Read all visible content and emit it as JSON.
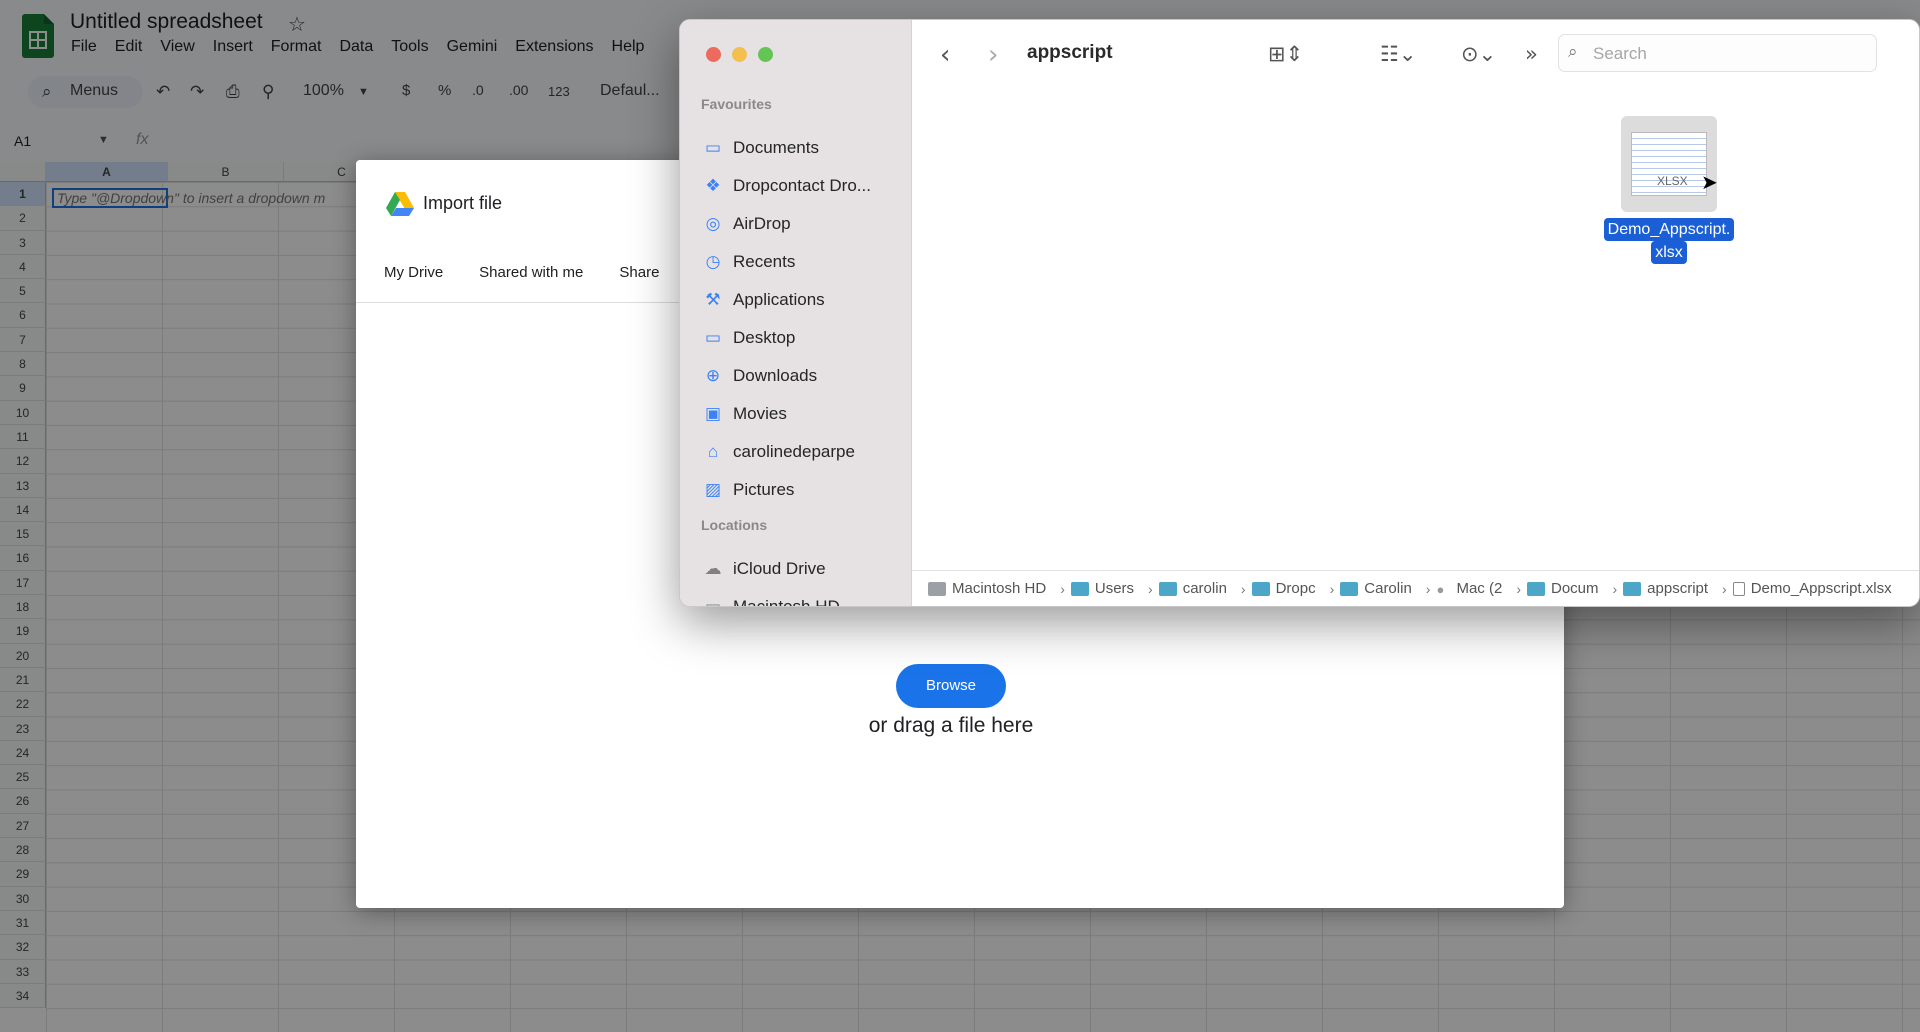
{
  "sheets": {
    "title": "Untitled spreadsheet",
    "menu": [
      "File",
      "Edit",
      "View",
      "Insert",
      "Format",
      "Data",
      "Tools",
      "Gemini",
      "Extensions",
      "Help"
    ],
    "toolbar": {
      "menus_label": "Menus",
      "zoom": "100%",
      "currency": "$",
      "percent": "%",
      "decrease_decimal": ".0",
      "increase_decimal": ".00",
      "number_format": "123",
      "font": "Defaul..."
    },
    "name_box": "A1",
    "formula_icon": "fx",
    "columns": [
      "A",
      "B",
      "C"
    ],
    "rows": [
      "1",
      "2",
      "3",
      "4",
      "5",
      "6",
      "7",
      "8",
      "9",
      "10",
      "11",
      "12",
      "13",
      "14",
      "15",
      "16",
      "17",
      "18",
      "19",
      "20",
      "21",
      "22",
      "23",
      "24",
      "25",
      "26",
      "27",
      "28",
      "29",
      "30",
      "31",
      "32",
      "33",
      "34"
    ],
    "cell_hint": "Type \"@Dropdown\" to insert a dropdown m"
  },
  "import_dialog": {
    "title": "Import file",
    "tabs": [
      "My Drive",
      "Shared with me",
      "Share"
    ],
    "browse_label": "Browse",
    "drag_text": "or drag a file here"
  },
  "finder": {
    "folder_title": "appscript",
    "search_placeholder": "Search",
    "sections": {
      "favourites": "Favourites",
      "locations": "Locations"
    },
    "favourites": [
      {
        "label": "Documents",
        "icon": "folder-icon"
      },
      {
        "label": "Dropcontact Dro...",
        "icon": "dropbox-icon"
      },
      {
        "label": "AirDrop",
        "icon": "airdrop-icon"
      },
      {
        "label": "Recents",
        "icon": "clock-icon"
      },
      {
        "label": "Applications",
        "icon": "applications-icon"
      },
      {
        "label": "Desktop",
        "icon": "desktop-icon"
      },
      {
        "label": "Downloads",
        "icon": "download-icon"
      },
      {
        "label": "Movies",
        "icon": "film-icon"
      },
      {
        "label": "carolinedeparpe",
        "icon": "home-icon"
      },
      {
        "label": "Pictures",
        "icon": "pictures-icon"
      }
    ],
    "locations": [
      {
        "label": "iCloud Drive",
        "icon": "cloud-icon"
      },
      {
        "label": "Macintosh HD",
        "icon": "disk-icon"
      }
    ],
    "file": {
      "name_line1": "Demo_Appscript.",
      "name_line2": "xlsx",
      "thumb_tag": "XLSX"
    },
    "path": [
      "Macintosh HD",
      "Users",
      "carolin",
      "Dropc",
      "Carolin",
      "Mac (2",
      "Docum",
      "appscript",
      "Demo_Appscript.xlsx"
    ]
  },
  "colors": {
    "accent_blue": "#1a73e8",
    "finder_selection": "#1a5fd6",
    "traffic_red": "#ed6a5e",
    "traffic_yellow": "#f5bf4f",
    "traffic_green": "#62c554"
  }
}
